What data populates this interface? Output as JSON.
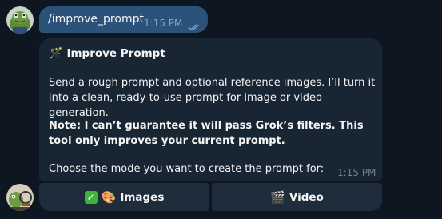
{
  "outgoing_message": {
    "text": "/improve_prompt",
    "time": "1:15 PM",
    "status_icon": "double-check-icon"
  },
  "incoming_message": {
    "title_icon": "🪄",
    "title": "Improve Prompt",
    "paragraph_1": "Send a rough prompt and optional reference images. I’ll turn it into a clean, ready-to-use prompt for image or video generation.",
    "paragraph_2": "Note: I can’t guarantee it will pass Grok’s filters. This tool only improves your current prompt.",
    "paragraph_3": "Choose the mode you want to create the prompt for:",
    "time": "1:15 PM"
  },
  "keyboard": {
    "images": {
      "icon_1": "✓",
      "icon_2": "🎨",
      "label": "Images"
    },
    "video": {
      "icon": "🎬",
      "label": "Video"
    }
  },
  "colors": {
    "background": "#0e1621",
    "outgoing_bubble": "#2b5278",
    "incoming_bubble": "#182533",
    "button": "#1f2c3b",
    "time_outgoing": "#7da8d3",
    "time_incoming": "#6d7f8f"
  }
}
